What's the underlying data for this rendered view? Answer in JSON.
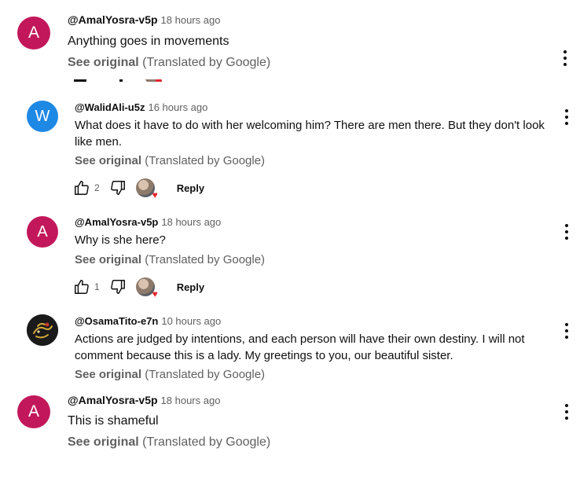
{
  "see_original": {
    "prefix": "See original",
    "suffix": "(Translated by Google)"
  },
  "reply_label": "Reply",
  "comments": [
    {
      "author": "@AmalYosra-v5p",
      "time": "18 hours ago",
      "avatar_letter": "A",
      "avatar_color": "#c2185b",
      "text": "Anything goes in movements"
    },
    {
      "author": "@WalidAli-u5z",
      "time": "16 hours ago",
      "avatar_letter": "W",
      "avatar_color": "#1e88e5",
      "text": "What does it have to do with her welcoming him? There are men there. But they don't look like men.",
      "likes": "2"
    },
    {
      "author": "@AmalYosra-v5p",
      "time": "18 hours ago",
      "avatar_letter": "A",
      "avatar_color": "#c2185b",
      "text": "Why is she here?",
      "likes": "1"
    },
    {
      "author": "@OsamaTito-e7n",
      "time": "10 hours ago",
      "avatar_color": "#1a1a1a",
      "text": "Actions are judged by intentions, and each person will have their own destiny. I will not comment because this is a lady. My greetings to you, our beautiful sister."
    },
    {
      "author": "@AmalYosra-v5p",
      "time": "18 hours ago",
      "avatar_letter": "A",
      "avatar_color": "#c2185b",
      "text": "This is shameful"
    }
  ]
}
